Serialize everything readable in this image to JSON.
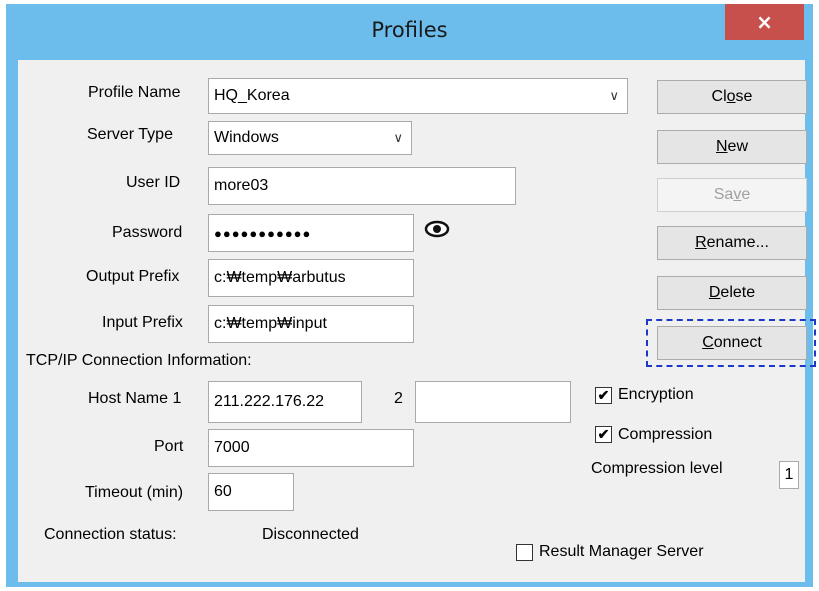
{
  "window": {
    "title": "Profiles",
    "close_glyph": "×"
  },
  "labels": {
    "profile_name": "Profile Name",
    "server_type": "Server Type",
    "user_id": "User ID",
    "password": "Password",
    "output_prefix": "Output Prefix",
    "input_prefix": "Input Prefix",
    "tcp_section": "TCP/IP Connection Information:",
    "host_name_1": "Host Name 1",
    "host_2": "2",
    "port": "Port",
    "timeout": "Timeout (min)",
    "connection_status": "Connection status:",
    "compression_level": "Compression level"
  },
  "fields": {
    "profile_name": "HQ_Korea",
    "server_type": "Windows",
    "user_id": "more03",
    "password": "●●●●●●●●●●●",
    "output_prefix": "c:₩temp₩arbutus",
    "input_prefix": "c:₩temp₩input",
    "host_name_1": "211.222.176.22",
    "host_name_2": "",
    "port": "7000",
    "timeout": "60",
    "compression_level": "1"
  },
  "status": {
    "connection": "Disconnected"
  },
  "buttons": {
    "close": {
      "pre": "Cl",
      "ul": "o",
      "post": "se"
    },
    "new": {
      "pre": "",
      "ul": "N",
      "post": "ew"
    },
    "save": {
      "pre": "Sa",
      "ul": "v",
      "post": "e"
    },
    "rename": {
      "pre": "",
      "ul": "R",
      "post": "ename..."
    },
    "delete": {
      "pre": "",
      "ul": "D",
      "post": "elete"
    },
    "connect": {
      "pre": "",
      "ul": "C",
      "post": "onnect"
    }
  },
  "checkboxes": {
    "encryption": {
      "label": "Encryption",
      "checked": true
    },
    "compression": {
      "label": "Compression",
      "checked": true
    },
    "result_manager": {
      "label": "Result Manager Server",
      "checked": false
    }
  },
  "icons": {
    "combo_arrow": "chevron-down-icon",
    "eye": "eye-icon"
  },
  "colors": {
    "titlebar": "#6cbcec",
    "close_button": "#c7504d",
    "focus_ring": "#1b39c8"
  }
}
